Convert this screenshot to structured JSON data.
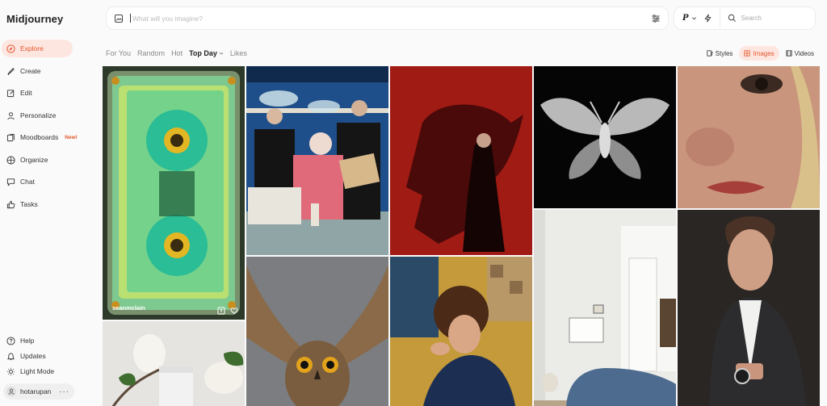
{
  "app": {
    "brand": "Midjourney"
  },
  "sidebar": {
    "items": [
      {
        "label": "Explore",
        "active": true
      },
      {
        "label": "Create"
      },
      {
        "label": "Edit"
      },
      {
        "label": "Personalize"
      },
      {
        "label": "Moodboards",
        "badge": "New!"
      },
      {
        "label": "Organize"
      },
      {
        "label": "Chat"
      },
      {
        "label": "Tasks"
      }
    ],
    "bottom": [
      {
        "label": "Help"
      },
      {
        "label": "Updates"
      },
      {
        "label": "Light Mode"
      }
    ],
    "user": {
      "name": "hotarupan",
      "more": "···"
    }
  },
  "topbar": {
    "prompt_placeholder": "What will you imagine?",
    "personalize_label": "P",
    "search_placeholder": "Search"
  },
  "tabs": {
    "items": [
      "For You",
      "Random",
      "Hot",
      "Top Day",
      "Likes"
    ],
    "active": "Top Day"
  },
  "view_tabs": {
    "items": [
      "Styles",
      "Images",
      "Videos"
    ],
    "active": "Images"
  },
  "gallery": {
    "tiles": [
      {
        "subject": "cassette-tape",
        "user": "seanmclain"
      },
      {
        "subject": "fashion-office-scene"
      },
      {
        "subject": "woman-panther-shadow"
      },
      {
        "subject": "moth-illustration"
      },
      {
        "subject": "woman-face-closeup"
      },
      {
        "subject": "magnolia-product"
      },
      {
        "subject": "owl-spread-wings"
      },
      {
        "subject": "woman-mosaic-painting"
      },
      {
        "subject": "white-interior-sofa"
      },
      {
        "subject": "man-portrait-suit"
      }
    ]
  },
  "colors": {
    "accent": "#e4572e",
    "accent_bg": "#fde6e0",
    "page_bg": "#fafafa"
  }
}
